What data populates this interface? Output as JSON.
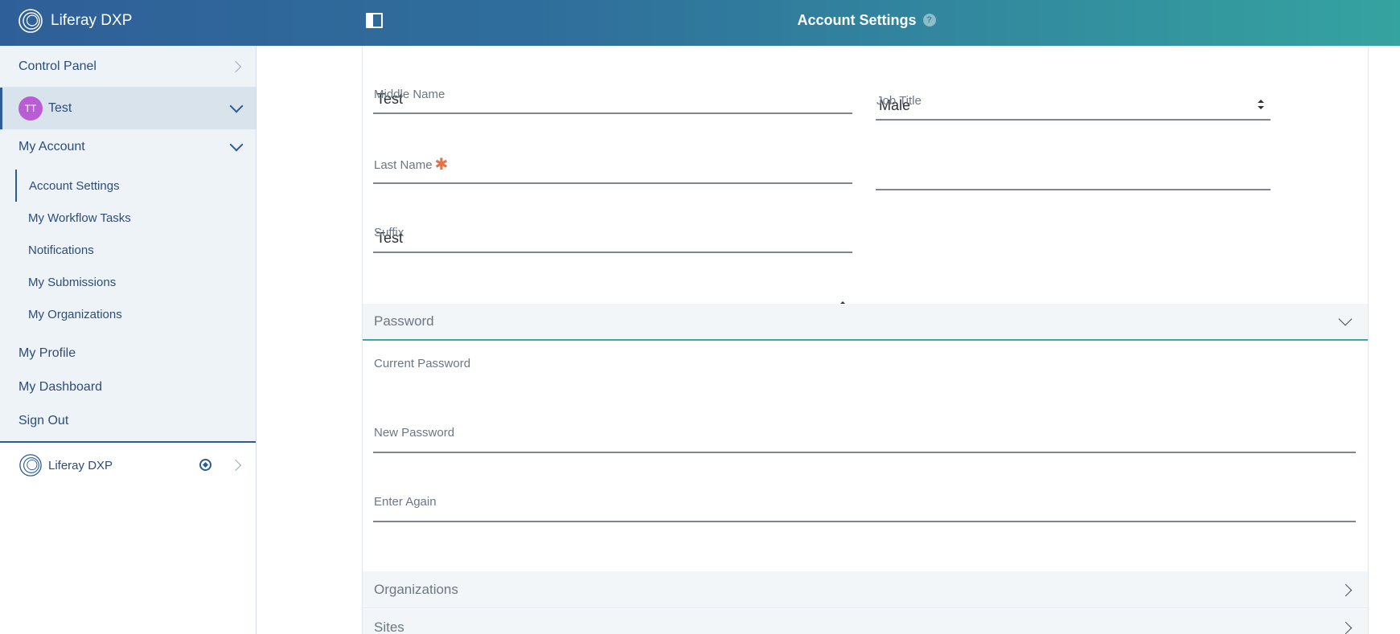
{
  "header": {
    "brand": "Liferay DXP",
    "title": "Account Settings",
    "help_icon": "?"
  },
  "sidebar": {
    "control_panel": "Control Panel",
    "user": {
      "initials": "TT",
      "name": "Test",
      "avatar_color": "#b85dd4"
    },
    "my_account": "My Account",
    "sub_items": [
      {
        "label": "Account Settings",
        "active": true
      },
      {
        "label": "My Workflow Tasks"
      },
      {
        "label": "Notifications"
      },
      {
        "label": "My Submissions"
      },
      {
        "label": "My Organizations"
      }
    ],
    "links": [
      "My Profile",
      "My Dashboard",
      "Sign Out"
    ],
    "site": "Liferay DXP"
  },
  "form": {
    "first_name_value": "Test",
    "gender_value": "Male",
    "middle_name_label": "Middle Name",
    "middle_name_value": "",
    "job_title_label": "Job Title",
    "job_title_value": "",
    "last_name_label": "Last Name",
    "last_name_value": "Test",
    "suffix_label": "Suffix",
    "suffix_value": ""
  },
  "password_section": {
    "title": "Password",
    "current_label": "Current Password",
    "new_label": "New Password",
    "again_label": "Enter Again"
  },
  "collapsed_sections": [
    "Organizations",
    "Sites"
  ],
  "colors": {
    "header_start": "#2f5f98",
    "header_end": "#35a3a0",
    "nav_text": "#2d4d78",
    "required": "#e0734a",
    "section_accent": "#3ba7a8"
  }
}
